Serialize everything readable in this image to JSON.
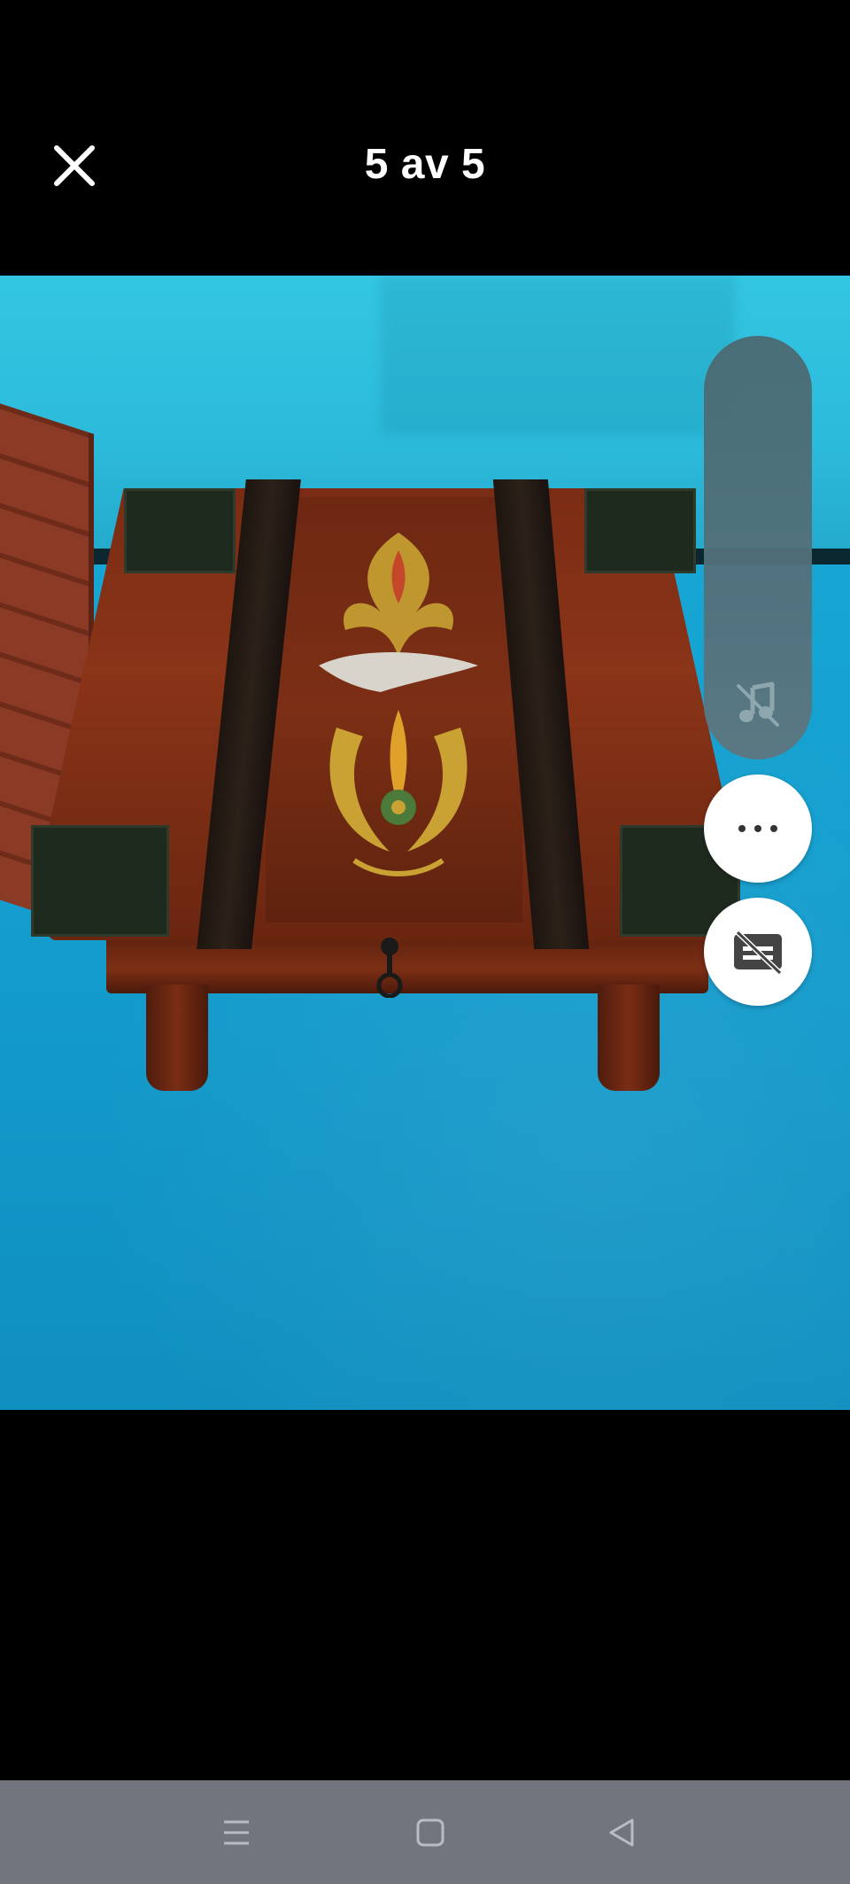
{
  "header": {
    "counter": "5 av 5",
    "close_icon": "close-icon"
  },
  "viewer": {
    "photo_description_icon": "photo",
    "controls": {
      "music_icon": "music-off-icon",
      "more_icon": "more-horizontal-icon",
      "captions_icon": "captions-off-icon"
    }
  },
  "navbar": {
    "icons": [
      "menu-icon",
      "home-icon",
      "back-icon"
    ]
  },
  "colors": {
    "background": "#000000",
    "navbar": "#72757d",
    "music_pill": "#53707a",
    "fab": "#ffffff"
  }
}
